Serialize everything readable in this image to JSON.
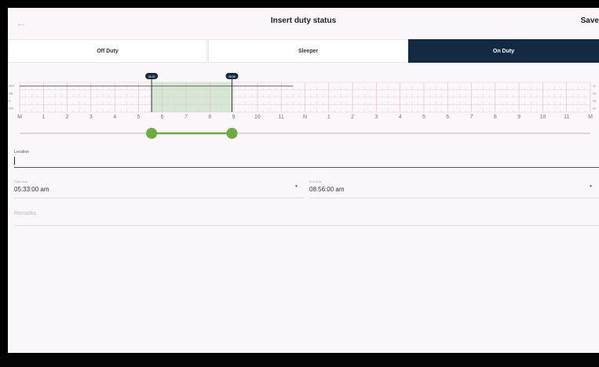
{
  "header": {
    "back_icon": "arrow-left-icon",
    "title": "Insert duty status",
    "save_label": "Save"
  },
  "tabs": [
    {
      "label": "Off Duty",
      "active": false
    },
    {
      "label": "Sleeper",
      "active": false
    },
    {
      "label": "On Duty",
      "active": true
    }
  ],
  "graph": {
    "row_labels_left": [
      "OFF",
      "SB",
      "D",
      "ON"
    ],
    "row_labels_right": [
      "11",
      "00",
      "00",
      "00"
    ],
    "hour_labels": [
      "M",
      "1",
      "2",
      "3",
      "4",
      "5",
      "6",
      "7",
      "8",
      "9",
      "10",
      "11",
      "N",
      "1",
      "2",
      "3",
      "4",
      "5",
      "6",
      "7",
      "8",
      "9",
      "10",
      "11",
      "M"
    ],
    "start_bubble": "05:33",
    "end_bubble": "08:56",
    "start_hour": 5.55,
    "end_hour": 8.93,
    "off_duty_line_end_hour": 11.5,
    "selection_color": "#d6e8d4",
    "slider_color": "#6bab3f",
    "accent_color": "#132a45"
  },
  "location": {
    "label": "Location",
    "value": ""
  },
  "start_time": {
    "label": "Start time",
    "value": "05:33:00 am"
  },
  "end_time": {
    "label": "End time",
    "value": "08:56:00 am"
  },
  "remarks": {
    "placeholder": "Remarks"
  }
}
